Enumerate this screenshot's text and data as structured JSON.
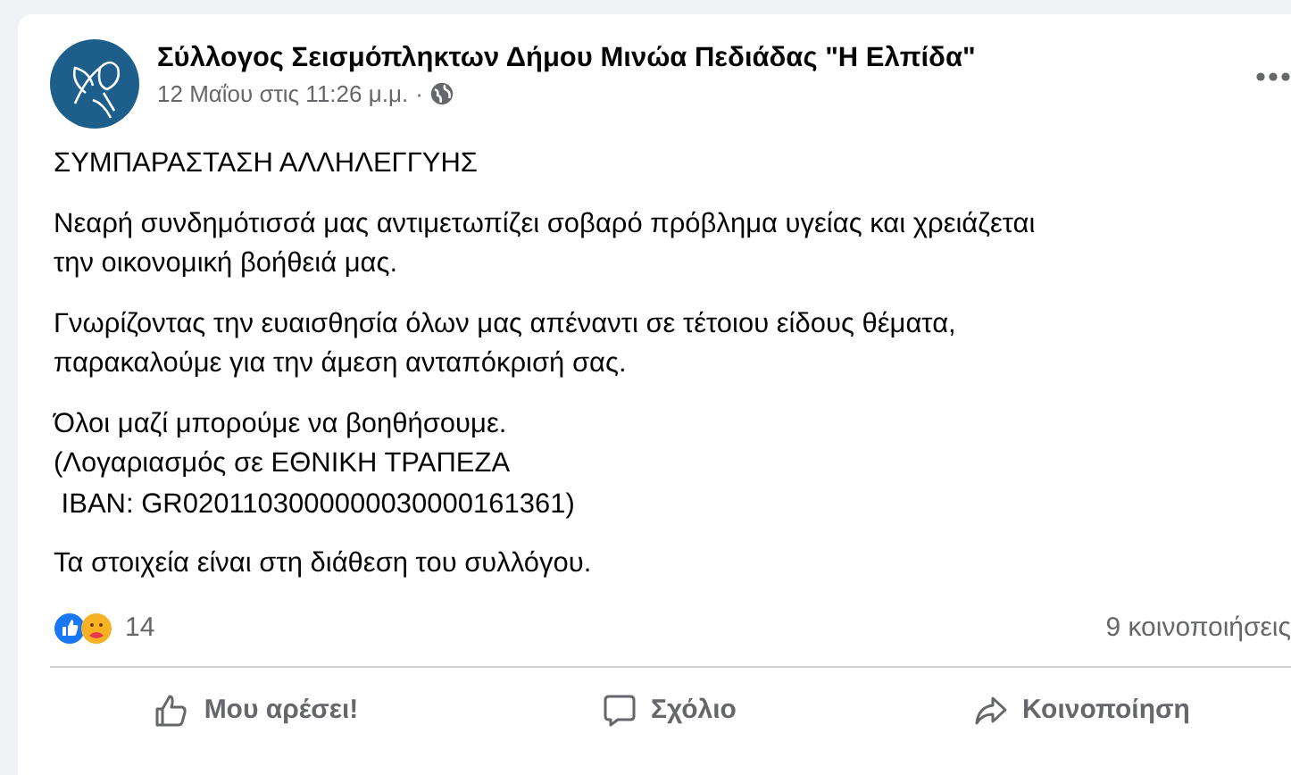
{
  "post": {
    "author": "Σύλλογος Σεισμόπληκτων Δήμου Μινώα Πεδιάδας \"Η Ελπίδα\"",
    "date": "12 Μαΐου στις 11:26 μ.μ.",
    "separator": "·",
    "paragraphs": [
      {
        "lines": [
          "ΣΥΜΠΑΡΑΣΤΑΣΗ ΑΛΛΗΛΕΓΓΥΗΣ"
        ]
      },
      {
        "lines": [
          "Νεαρή συνδημότισσά μας αντιμετωπίζει σοβαρό πρόβλημα υγείας και χρειάζεται",
          "την οικονομική βοήθειά μας."
        ]
      },
      {
        "lines": [
          "Γνωρίζοντας την ευαισθησία όλων μας απέναντι σε τέτοιου είδους θέματα,",
          "παρακαλούμε για την άμεση ανταπόκρισή σας."
        ]
      },
      {
        "lines": [
          "Όλοι μαζί μπορούμε να βοηθήσουμε.",
          "(Λογαριασμός σε ΕΘΝΙΚΗ ΤΡΑΠΕΖΑ",
          " IBAN: GR0201103000000030000161361)"
        ]
      },
      {
        "lines": [
          "Τα στοιχεία είναι στη διάθεση του συλλόγου."
        ]
      }
    ],
    "reaction_count": "14",
    "shares": "9 κοινοποιήσεις",
    "actions": [
      {
        "kind": "like",
        "label": "Μου αρέσει!"
      },
      {
        "kind": "comment",
        "label": "Σχόλιο"
      },
      {
        "kind": "share",
        "label": "Κοινοποίηση"
      }
    ]
  }
}
